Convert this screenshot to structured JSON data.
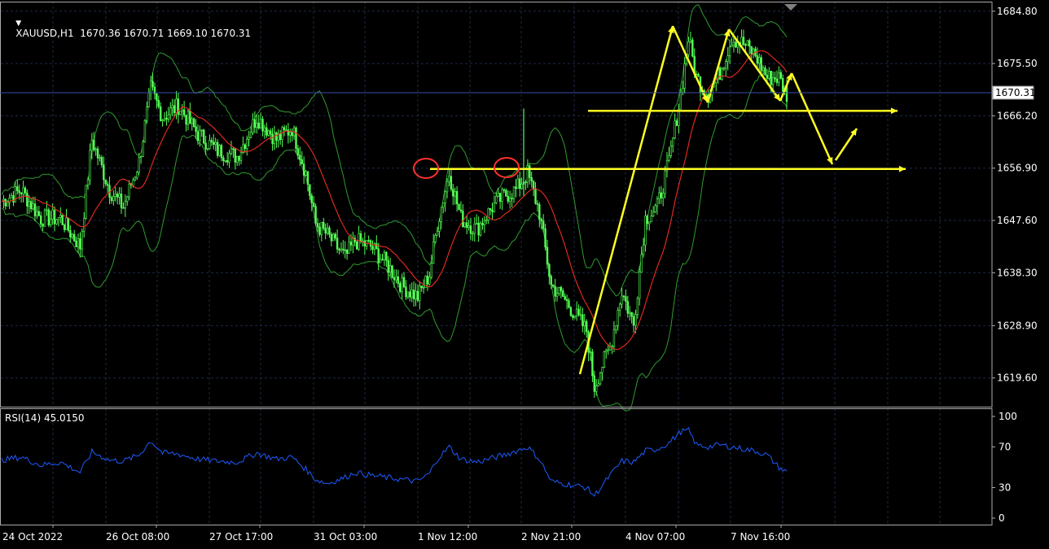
{
  "header": {
    "symbol_line": "XAUUSD,H1  1670.36 1670.71 1669.10 1670.31",
    "rsi_label": "RSI(14) 45.0150"
  },
  "colors": {
    "background": "#000000",
    "grid": "#1c2a44",
    "candle": "#55ff55",
    "bollinger": "#2e9b2e",
    "ma": "#ff2020",
    "rsi_line": "#1e5bff",
    "annotation": "#ffff22",
    "circle": "#ff3030",
    "price_line": "#3a4ea8"
  },
  "chart_data": [
    {
      "type": "candlestick",
      "title": "XAUUSD,H1",
      "ohlc_last": {
        "open": 1670.36,
        "high": 1670.71,
        "low": 1669.1,
        "close": 1670.31
      },
      "current_price": "1670.31",
      "y_ticks": [
        "1684.80",
        "1675.50",
        "1666.20",
        "1656.90",
        "1647.60",
        "1638.30",
        "1628.90",
        "1619.60"
      ],
      "ylim": [
        1614.5,
        1686.5
      ],
      "x_ticks": [
        "24 Oct 2022",
        "26 Oct 08:00",
        "27 Oct 17:00",
        "31 Oct 03:00",
        "1 Nov 12:00",
        "2 Nov 21:00",
        "4 Nov 07:00",
        "7 Nov 16:00"
      ],
      "close_path": [
        [
          0,
          1651
        ],
        [
          10,
          1653
        ],
        [
          20,
          1648
        ],
        [
          30,
          1648
        ],
        [
          40,
          1643
        ],
        [
          46,
          1662
        ],
        [
          55,
          1653
        ],
        [
          62,
          1650
        ],
        [
          70,
          1658
        ],
        [
          76,
          1671
        ],
        [
          82,
          1666
        ],
        [
          90,
          1668
        ],
        [
          100,
          1663
        ],
        [
          110,
          1660
        ],
        [
          120,
          1659
        ],
        [
          130,
          1666
        ],
        [
          140,
          1662
        ],
        [
          148,
          1664
        ],
        [
          155,
          1656
        ],
        [
          160,
          1647
        ],
        [
          166,
          1645
        ],
        [
          175,
          1641
        ],
        [
          180,
          1644
        ],
        [
          188,
          1643
        ],
        [
          196,
          1640
        ],
        [
          204,
          1636
        ],
        [
          212,
          1634
        ],
        [
          218,
          1638
        ],
        [
          222,
          1647
        ],
        [
          228,
          1656
        ],
        [
          234,
          1648
        ],
        [
          242,
          1646
        ],
        [
          250,
          1650
        ],
        [
          256,
          1652
        ],
        [
          262,
          1653
        ],
        [
          268,
          1656
        ],
        [
          274,
          1649
        ],
        [
          280,
          1636
        ],
        [
          286,
          1634
        ],
        [
          292,
          1631
        ],
        [
          298,
          1628
        ],
        [
          302,
          1618
        ],
        [
          306,
          1622
        ],
        [
          310,
          1625
        ],
        [
          316,
          1635
        ],
        [
          322,
          1629
        ],
        [
          328,
          1648
        ],
        [
          334,
          1650
        ],
        [
          340,
          1658
        ],
        [
          346,
          1670
        ],
        [
          350,
          1680
        ],
        [
          354,
          1673
        ],
        [
          360,
          1670
        ],
        [
          366,
          1674
        ],
        [
          372,
          1680
        ],
        [
          378,
          1679
        ],
        [
          384,
          1677
        ],
        [
          390,
          1673
        ],
        [
          396,
          1673
        ],
        [
          400,
          1670
        ]
      ],
      "rsi": {
        "label": "RSI(14) 45.0150",
        "y_ticks": [
          "100",
          "70",
          "30",
          "0"
        ],
        "ylim": [
          0,
          100
        ],
        "values": [
          [
            0,
            57
          ],
          [
            10,
            60
          ],
          [
            20,
            52
          ],
          [
            30,
            55
          ],
          [
            40,
            45
          ],
          [
            46,
            65
          ],
          [
            55,
            57
          ],
          [
            62,
            56
          ],
          [
            70,
            62
          ],
          [
            76,
            76
          ],
          [
            82,
            64
          ],
          [
            90,
            63
          ],
          [
            100,
            58
          ],
          [
            110,
            56
          ],
          [
            120,
            55
          ],
          [
            130,
            64
          ],
          [
            140,
            58
          ],
          [
            148,
            60
          ],
          [
            155,
            48
          ],
          [
            160,
            38
          ],
          [
            166,
            34
          ],
          [
            175,
            40
          ],
          [
            180,
            45
          ],
          [
            188,
            42
          ],
          [
            196,
            40
          ],
          [
            204,
            38
          ],
          [
            212,
            36
          ],
          [
            218,
            44
          ],
          [
            222,
            58
          ],
          [
            228,
            70
          ],
          [
            234,
            58
          ],
          [
            242,
            55
          ],
          [
            250,
            59
          ],
          [
            256,
            62
          ],
          [
            262,
            66
          ],
          [
            268,
            70
          ],
          [
            274,
            58
          ],
          [
            280,
            36
          ],
          [
            286,
            34
          ],
          [
            292,
            32
          ],
          [
            298,
            30
          ],
          [
            302,
            22
          ],
          [
            306,
            32
          ],
          [
            310,
            42
          ],
          [
            316,
            56
          ],
          [
            322,
            55
          ],
          [
            328,
            66
          ],
          [
            334,
            68
          ],
          [
            340,
            74
          ],
          [
            346,
            85
          ],
          [
            350,
            86
          ],
          [
            354,
            72
          ],
          [
            360,
            70
          ],
          [
            366,
            72
          ],
          [
            372,
            70
          ],
          [
            378,
            68
          ],
          [
            384,
            66
          ],
          [
            390,
            62
          ],
          [
            396,
            50
          ],
          [
            400,
            45
          ]
        ]
      },
      "annotations": {
        "resistance_level": 1656.9,
        "upper_level": 1666.8,
        "circles": 2
      }
    }
  ]
}
